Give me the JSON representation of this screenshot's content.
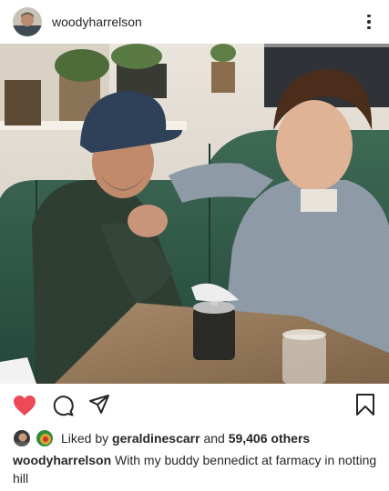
{
  "post": {
    "username": "woodyharrelson",
    "avatar_icon": "user-avatar-icon",
    "more_icon": "more-options-icon"
  },
  "actions": {
    "like_icon": "heart-filled-icon",
    "like_color": "#ed4956",
    "comment_icon": "comment-icon",
    "share_icon": "send-icon",
    "save_icon": "bookmark-icon"
  },
  "likes": {
    "prefix": "Liked by",
    "liked_by_user": "geraldinescarr",
    "connector": "and",
    "others_count": "59,406 others"
  },
  "caption": {
    "username": "woodyharrelson",
    "text": "With my buddy bennedict at farmacy in notting hill"
  }
}
